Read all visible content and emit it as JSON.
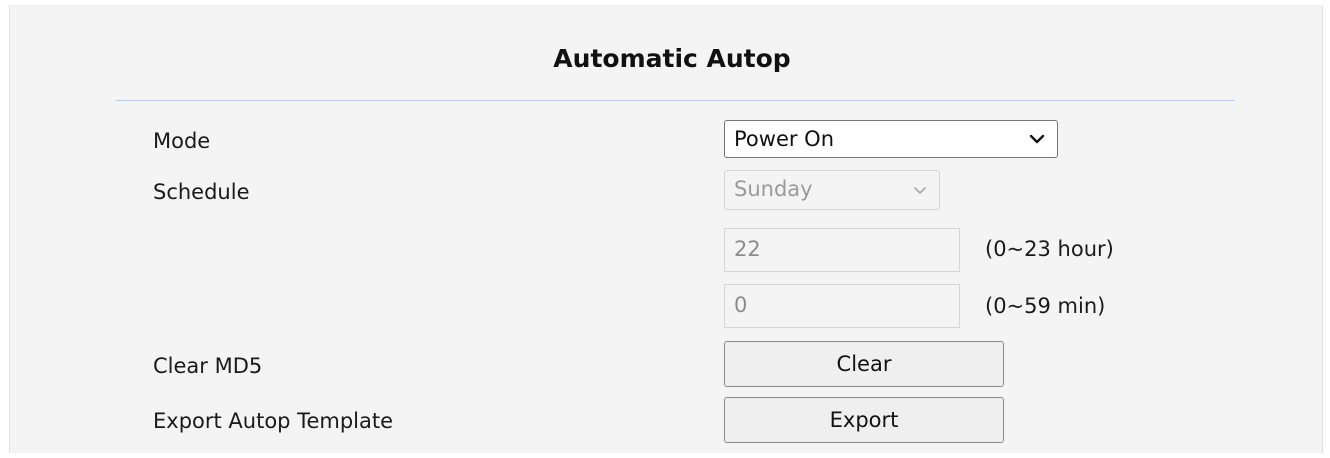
{
  "section": {
    "title": "Automatic Autop"
  },
  "fields": {
    "mode": {
      "label": "Mode",
      "value": "Power On"
    },
    "schedule": {
      "label": "Schedule",
      "value": "Sunday"
    },
    "hour": {
      "value": "22",
      "hint": "(0~23 hour)"
    },
    "minute": {
      "value": "0",
      "hint": "(0~59 min)"
    },
    "clear_md5": {
      "label": "Clear MD5",
      "button": "Clear"
    },
    "export_template": {
      "label": "Export Autop Template",
      "button": "Export"
    }
  },
  "icons": {
    "mode_dropdown": "chevron-down-icon",
    "schedule_dropdown": "chevron-down-icon"
  }
}
